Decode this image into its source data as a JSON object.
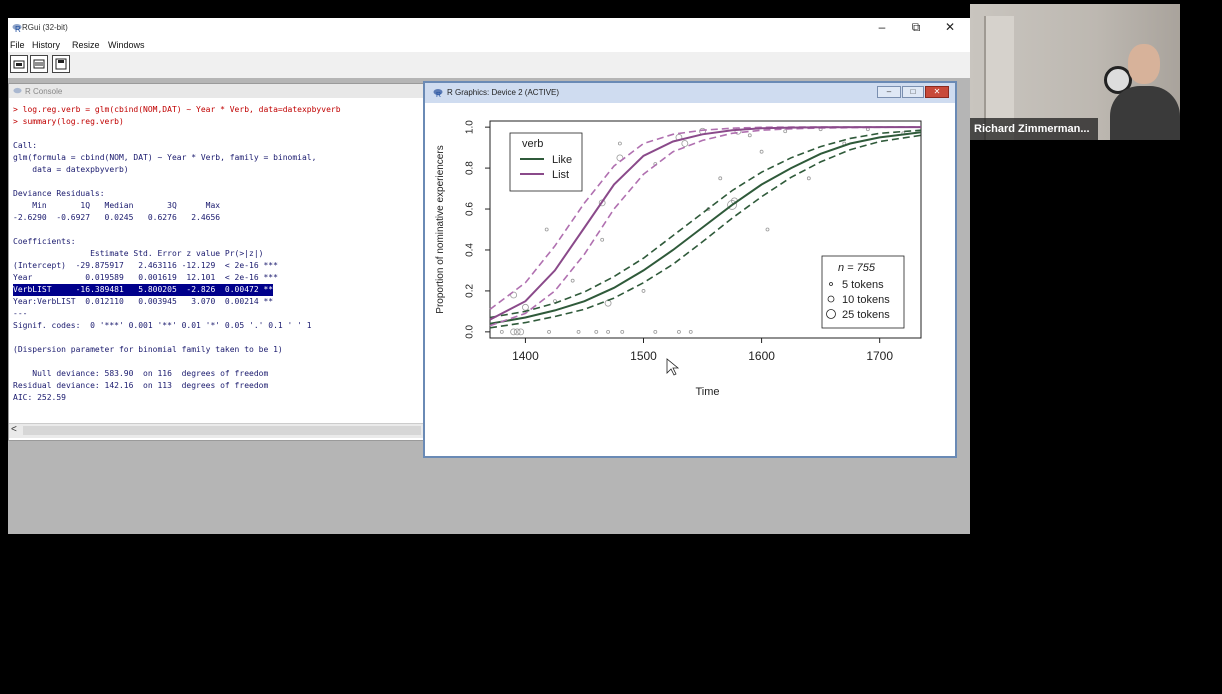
{
  "rgui": {
    "title": "RGui (32-bit)",
    "window_controls": {
      "minimize": "–",
      "maximize": "⧉",
      "close": "✕"
    },
    "menu": [
      "File",
      "History",
      "Resize",
      "Windows"
    ]
  },
  "console": {
    "title": "R Console",
    "lines": [
      "> log.reg.verb = glm(cbind(NOM,DAT) ~ Year * Verb, data=datexpbyverb",
      "> summary(log.reg.verb)",
      "",
      "Call:",
      "glm(formula = cbind(NOM, DAT) ~ Year * Verb, family = binomial,",
      "    data = datexpbyverb)",
      "",
      "Deviance Residuals:",
      "    Min       1Q   Median       3Q      Max",
      "-2.6290  -0.6927   0.0245   0.6276   2.4656",
      "",
      "Coefficients:",
      "                Estimate Std. Error z value Pr(>|z|)",
      "(Intercept)  -29.875917   2.463116 -12.129  < 2e-16 ***",
      "Year           0.019589   0.001619  12.101  < 2e-16 ***",
      "VerbLIST     -16.389481   5.800205  -2.826  0.00472 **",
      "Year:VerbLIST  0.012110   0.003945   3.070  0.00214 **",
      "---",
      "Signif. codes:  0 '***' 0.001 '**' 0.01 '*' 0.05 '.' 0.1 ' ' 1",
      "",
      "(Dispersion parameter for binomial family taken to be 1)",
      "",
      "    Null deviance: 583.90  on 116  degrees of freedom",
      "Residual deviance: 142.16  on 113  degrees of freedom",
      "AIC: 252.59"
    ],
    "scroll_left": "<"
  },
  "graphics": {
    "title": "R Graphics: Device 2 (ACTIVE)"
  },
  "webcam": {
    "name": "Richard Zimmerman..."
  },
  "chart_data": {
    "type": "line",
    "xlabel": "Time",
    "ylabel": "Proportion of nominative experiencers",
    "xlim": [
      1370,
      1735
    ],
    "ylim": [
      -0.03,
      1.03
    ],
    "xticks": [
      "1400",
      "1500",
      "1600",
      "1700"
    ],
    "xtick_values": [
      1400,
      1500,
      1600,
      1700
    ],
    "yticks": [
      "0.0",
      "0.2",
      "0.4",
      "0.6",
      "0.8",
      "1.0"
    ],
    "ytick_values": [
      0,
      0.2,
      0.4,
      0.6,
      0.8,
      1.0
    ],
    "legend_verb": {
      "title": "verb",
      "entries": [
        "Like",
        "List"
      ],
      "placement": "top-left"
    },
    "legend_size": {
      "n_label": "n = 755",
      "entries": [
        "5 tokens",
        "10 tokens",
        "25 tokens"
      ],
      "placement": "bottom-right"
    },
    "colors": {
      "Like": "#2f5a3a",
      "List": "#8a4a8a",
      "List_ci": "#b070b0",
      "points": "#999999"
    },
    "series": [
      {
        "name": "Like",
        "x": [
          1370,
          1400,
          1425,
          1450,
          1475,
          1500,
          1525,
          1550,
          1575,
          1600,
          1625,
          1650,
          1675,
          1700,
          1735
        ],
        "y": [
          0.04,
          0.07,
          0.105,
          0.15,
          0.215,
          0.3,
          0.4,
          0.51,
          0.62,
          0.72,
          0.8,
          0.87,
          0.92,
          0.95,
          0.975
        ],
        "lower": [
          0.02,
          0.045,
          0.075,
          0.11,
          0.165,
          0.24,
          0.33,
          0.44,
          0.555,
          0.66,
          0.755,
          0.83,
          0.89,
          0.93,
          0.96
        ],
        "upper": [
          0.07,
          0.1,
          0.14,
          0.195,
          0.27,
          0.36,
          0.47,
          0.58,
          0.69,
          0.78,
          0.85,
          0.905,
          0.945,
          0.97,
          0.985
        ]
      },
      {
        "name": "List",
        "x": [
          1370,
          1400,
          1425,
          1450,
          1475,
          1500,
          1525,
          1550,
          1575,
          1600,
          1625,
          1650,
          1700,
          1735
        ],
        "y": [
          0.06,
          0.15,
          0.3,
          0.51,
          0.72,
          0.86,
          0.93,
          0.965,
          0.985,
          0.995,
          0.998,
          0.999,
          1.0,
          1.0
        ],
        "lower": [
          0.03,
          0.09,
          0.2,
          0.38,
          0.6,
          0.77,
          0.88,
          0.935,
          0.97,
          0.985,
          0.992,
          0.996,
          0.999,
          1.0
        ],
        "upper": [
          0.11,
          0.24,
          0.42,
          0.63,
          0.81,
          0.92,
          0.965,
          0.985,
          0.995,
          0.999,
          1.0,
          1.0,
          1.0,
          1.0
        ]
      }
    ],
    "points": [
      {
        "x": 1380,
        "y": 0.0,
        "s": 1
      },
      {
        "x": 1390,
        "y": 0.0,
        "s": 2
      },
      {
        "x": 1393,
        "y": 0.0,
        "s": 2
      },
      {
        "x": 1396,
        "y": 0.0,
        "s": 2
      },
      {
        "x": 1420,
        "y": 0.0,
        "s": 1
      },
      {
        "x": 1445,
        "y": 0.0,
        "s": 1
      },
      {
        "x": 1460,
        "y": 0.0,
        "s": 1
      },
      {
        "x": 1470,
        "y": 0.0,
        "s": 1
      },
      {
        "x": 1482,
        "y": 0.0,
        "s": 1
      },
      {
        "x": 1510,
        "y": 0.0,
        "s": 1
      },
      {
        "x": 1530,
        "y": 0.0,
        "s": 1
      },
      {
        "x": 1540,
        "y": 0.0,
        "s": 1
      },
      {
        "x": 1390,
        "y": 0.18,
        "s": 2
      },
      {
        "x": 1400,
        "y": 0.12,
        "s": 2
      },
      {
        "x": 1425,
        "y": 0.15,
        "s": 1
      },
      {
        "x": 1440,
        "y": 0.25,
        "s": 1
      },
      {
        "x": 1418,
        "y": 0.5,
        "s": 1
      },
      {
        "x": 1432,
        "y": 0.75,
        "s": 1
      },
      {
        "x": 1465,
        "y": 0.63,
        "s": 2
      },
      {
        "x": 1470,
        "y": 0.14,
        "s": 2
      },
      {
        "x": 1465,
        "y": 0.45,
        "s": 1
      },
      {
        "x": 1480,
        "y": 0.85,
        "s": 2
      },
      {
        "x": 1500,
        "y": 0.2,
        "s": 1
      },
      {
        "x": 1510,
        "y": 0.82,
        "s": 1
      },
      {
        "x": 1530,
        "y": 0.95,
        "s": 2
      },
      {
        "x": 1535,
        "y": 0.92,
        "s": 2
      },
      {
        "x": 1550,
        "y": 0.98,
        "s": 2
      },
      {
        "x": 1565,
        "y": 0.75,
        "s": 1
      },
      {
        "x": 1575,
        "y": 0.62,
        "s": 3
      },
      {
        "x": 1577,
        "y": 0.64,
        "s": 2
      },
      {
        "x": 1580,
        "y": 0.98,
        "s": 2
      },
      {
        "x": 1590,
        "y": 0.96,
        "s": 1
      },
      {
        "x": 1600,
        "y": 0.88,
        "s": 1
      },
      {
        "x": 1605,
        "y": 0.5,
        "s": 1
      },
      {
        "x": 1620,
        "y": 0.98,
        "s": 1
      },
      {
        "x": 1640,
        "y": 0.75,
        "s": 1
      },
      {
        "x": 1650,
        "y": 0.99,
        "s": 1
      },
      {
        "x": 1670,
        "y": 0.92,
        "s": 1
      },
      {
        "x": 1690,
        "y": 0.99,
        "s": 1
      },
      {
        "x": 1720,
        "y": 0.97,
        "s": 1
      },
      {
        "x": 1555,
        "y": 0.6,
        "s": 1
      },
      {
        "x": 1480,
        "y": 0.92,
        "s": 1
      }
    ]
  }
}
